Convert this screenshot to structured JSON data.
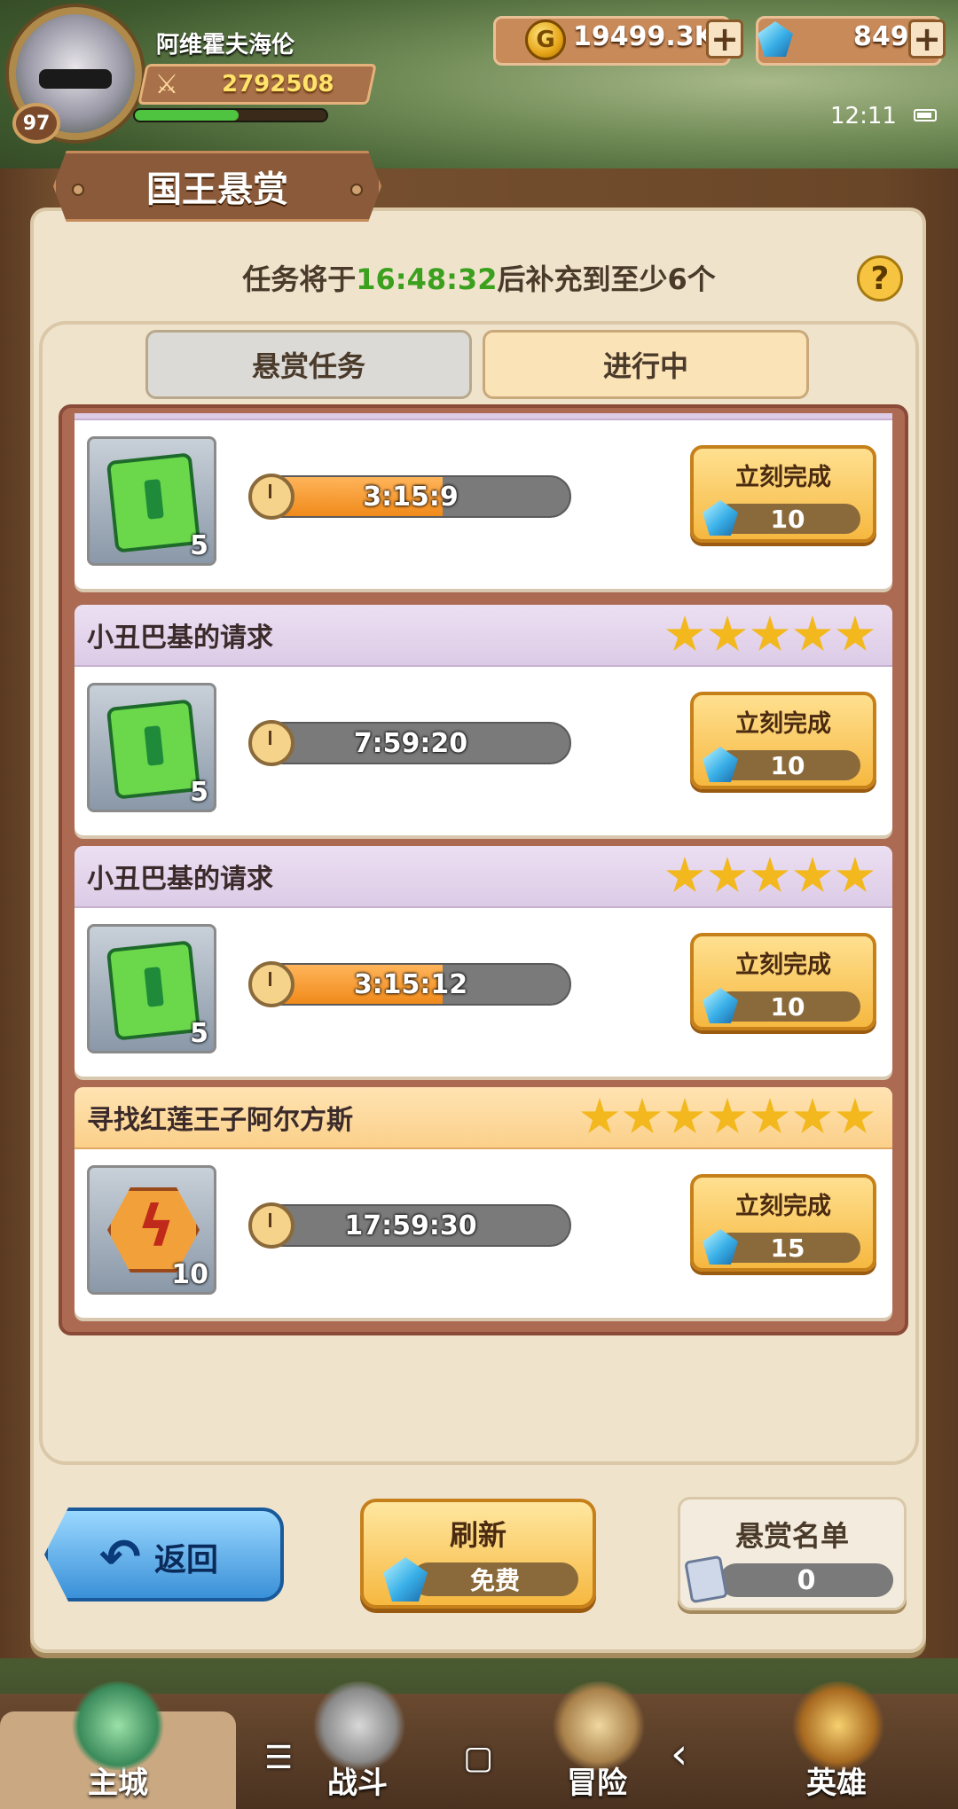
{
  "player": {
    "name": "阿维霍夫海伦",
    "level": "97",
    "power": "2792508",
    "exp_fraction": 0.54
  },
  "currency": {
    "gold": "19499.3K",
    "gems": "849",
    "plus_label": "+"
  },
  "status": {
    "time": "12:11"
  },
  "page": {
    "title": "国王悬赏"
  },
  "refill": {
    "prefix": "任务将于",
    "time": "16:48:32",
    "suffix": "后补充到至少6个"
  },
  "help_label": "?",
  "tabs": [
    {
      "label": "悬赏任务",
      "active": false
    },
    {
      "label": "进行中",
      "active": true
    }
  ],
  "quests": [
    {
      "title": "",
      "stars": 0,
      "rarity": "purple",
      "item": "scroll-icon",
      "qty": "5",
      "timer": "3:15:9",
      "progress": 0.6,
      "button": "立刻完成",
      "cost": "10"
    },
    {
      "title": "小丑巴基的请求",
      "stars": 5,
      "rarity": "purple",
      "item": "scroll-icon",
      "qty": "5",
      "timer": "7:59:20",
      "progress": 0.0,
      "button": "立刻完成",
      "cost": "10"
    },
    {
      "title": "小丑巴基的请求",
      "stars": 5,
      "rarity": "purple",
      "item": "scroll-icon",
      "qty": "5",
      "timer": "3:15:12",
      "progress": 0.6,
      "button": "立刻完成",
      "cost": "10"
    },
    {
      "title": "寻找红莲王子阿尔方斯",
      "stars": 7,
      "rarity": "gold",
      "item": "rune-icon",
      "qty": "10",
      "timer": "17:59:30",
      "progress": 0.0,
      "button": "立刻完成",
      "cost": "15"
    }
  ],
  "buttons": {
    "back": "返回",
    "refresh": "刷新",
    "refresh_cost": "免费",
    "roster": "悬赏名单",
    "roster_count": "0"
  },
  "nav": [
    {
      "label": "主城",
      "active": true
    },
    {
      "label": "战斗"
    },
    {
      "label": "冒险"
    },
    {
      "label": "英雄"
    }
  ],
  "sysnav": {
    "menu": "☰",
    "home": "▢",
    "back": "‹"
  }
}
